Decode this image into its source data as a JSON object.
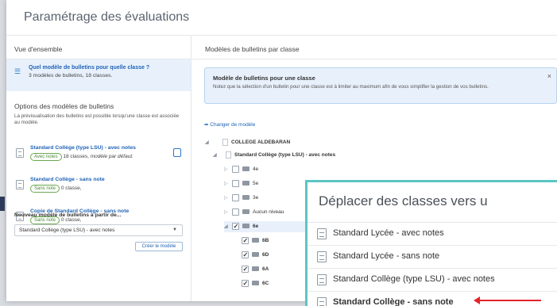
{
  "page": {
    "title": "Paramétrage des évaluations"
  },
  "left": {
    "overview_header": "Vue d'ensemble",
    "selected": {
      "title": "Quel modèle de bulletins pour quelle classe ?",
      "subtitle": "3 modèles de bulletins, 18 classes."
    },
    "options_header": "Options des modèles de bulletins",
    "options_desc": "La prévisualisation des bulletins est possible lorsqu'une classe est associée au modèle.",
    "models": [
      {
        "title": "Standard Collège (type LSU) - avec notes",
        "pill": "Avec notes",
        "info": "18 classes,",
        "extra": "modèle par défaut."
      },
      {
        "title": "Standard Collège - sans note",
        "pill": "Sans note",
        "info": "0 classe,",
        "extra": ""
      },
      {
        "title": "Copie de Standard Collège - sans note",
        "pill": "Sans note",
        "info": "0 classe,",
        "extra": ""
      }
    ],
    "new_model_label": "Nouveau modèle de bulletins à partir de...",
    "new_model_value": "Standard Collège (type LSU) - avec notes",
    "create_button": "Créer le modèle"
  },
  "right": {
    "header": "Modèles de bulletins par classe",
    "info": {
      "title": "Modèle de bulletins pour une classe",
      "text": "Notez que la sélection d'un bulletin pour une classe est à limiter au maximum afin de vous simplifier la gestion de vos bulletins."
    },
    "change_link": "Changer de modèle",
    "tree": {
      "root": "COLLEGE ALDEBARAN",
      "model": "Standard Collège (type LSU) - avec notes",
      "levels": [
        "4e",
        "5e",
        "3e",
        "Aucun niveau",
        "6e"
      ],
      "classes": [
        "6B",
        "6D",
        "6A",
        "6C"
      ]
    }
  },
  "overlay": {
    "title": "Déplacer des classes vers u",
    "items": [
      "Standard Lycée - avec notes",
      "Standard Lycée - sans note",
      "Standard Collège (type LSU) - avec notes",
      "Standard Collège - sans note"
    ]
  }
}
